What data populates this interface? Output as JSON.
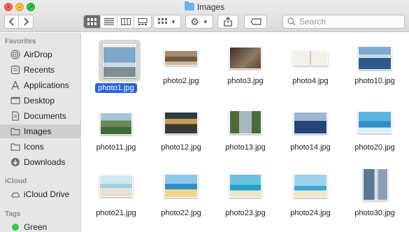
{
  "window": {
    "title": "Images"
  },
  "toolbar": {
    "back_icon": "chevron-left-icon",
    "forward_icon": "chevron-right-icon",
    "view_modes": [
      "icon-view",
      "list-view",
      "column-view",
      "gallery-view"
    ],
    "active_view": "icon-view",
    "search_placeholder": "Search"
  },
  "sidebar": {
    "favorites_header": "Favorites",
    "favorites": [
      {
        "label": "AirDrop",
        "icon": "airdrop-icon"
      },
      {
        "label": "Recents",
        "icon": "recents-icon"
      },
      {
        "label": "Applications",
        "icon": "applications-icon"
      },
      {
        "label": "Desktop",
        "icon": "desktop-icon"
      },
      {
        "label": "Documents",
        "icon": "documents-icon"
      },
      {
        "label": "Images",
        "icon": "folder-icon",
        "selected": true
      },
      {
        "label": "Icons",
        "icon": "folder-icon"
      },
      {
        "label": "Downloads",
        "icon": "downloads-icon"
      }
    ],
    "icloud_header": "iCloud",
    "icloud": [
      {
        "label": "iCloud Drive",
        "icon": "cloud-icon"
      }
    ],
    "tags_header": "Tags",
    "tags": [
      {
        "label": "Green",
        "color": "#34c84a"
      }
    ]
  },
  "files": [
    {
      "name": "photo1.jpg",
      "selected": true,
      "colors": [
        "#5f8fb8",
        "#a9c6dc"
      ]
    },
    {
      "name": "photo2.jpg",
      "colors": [
        "#8a6f4e",
        "#c9b9a0"
      ]
    },
    {
      "name": "photo3.jpg",
      "colors": [
        "#3b2f26",
        "#8e7a62"
      ]
    },
    {
      "name": "photo4.jpg",
      "colors": [
        "#f0ece6",
        "#d8c9c0"
      ]
    },
    {
      "name": "photo10.jpg",
      "colors": [
        "#2c5b8e",
        "#8fb3d0"
      ]
    },
    {
      "name": "photo11.jpg",
      "colors": [
        "#3d6b3a",
        "#a5c4d8"
      ]
    },
    {
      "name": "photo12.jpg",
      "colors": [
        "#2e3c44",
        "#c79c52"
      ]
    },
    {
      "name": "photo13.jpg",
      "colors": [
        "#4f6a3a",
        "#a5b8c2"
      ]
    },
    {
      "name": "photo14.jpg",
      "colors": [
        "#23457a",
        "#9fb5d1"
      ]
    },
    {
      "name": "photo20.jpg",
      "colors": [
        "#3f9fd0",
        "#dfeef5"
      ]
    },
    {
      "name": "photo21.jpg",
      "colors": [
        "#9fd1e8",
        "#e9e0cf"
      ]
    },
    {
      "name": "photo22.jpg",
      "colors": [
        "#2f8ec7",
        "#f1d58a"
      ]
    },
    {
      "name": "photo23.jpg",
      "colors": [
        "#1fa3c9",
        "#efe5c8"
      ]
    },
    {
      "name": "photo24.jpg",
      "colors": [
        "#3aa8d6",
        "#f3e6c4"
      ]
    },
    {
      "name": "photo30.jpg",
      "colors": [
        "#5a7796",
        "#d7dde4"
      ]
    }
  ]
}
